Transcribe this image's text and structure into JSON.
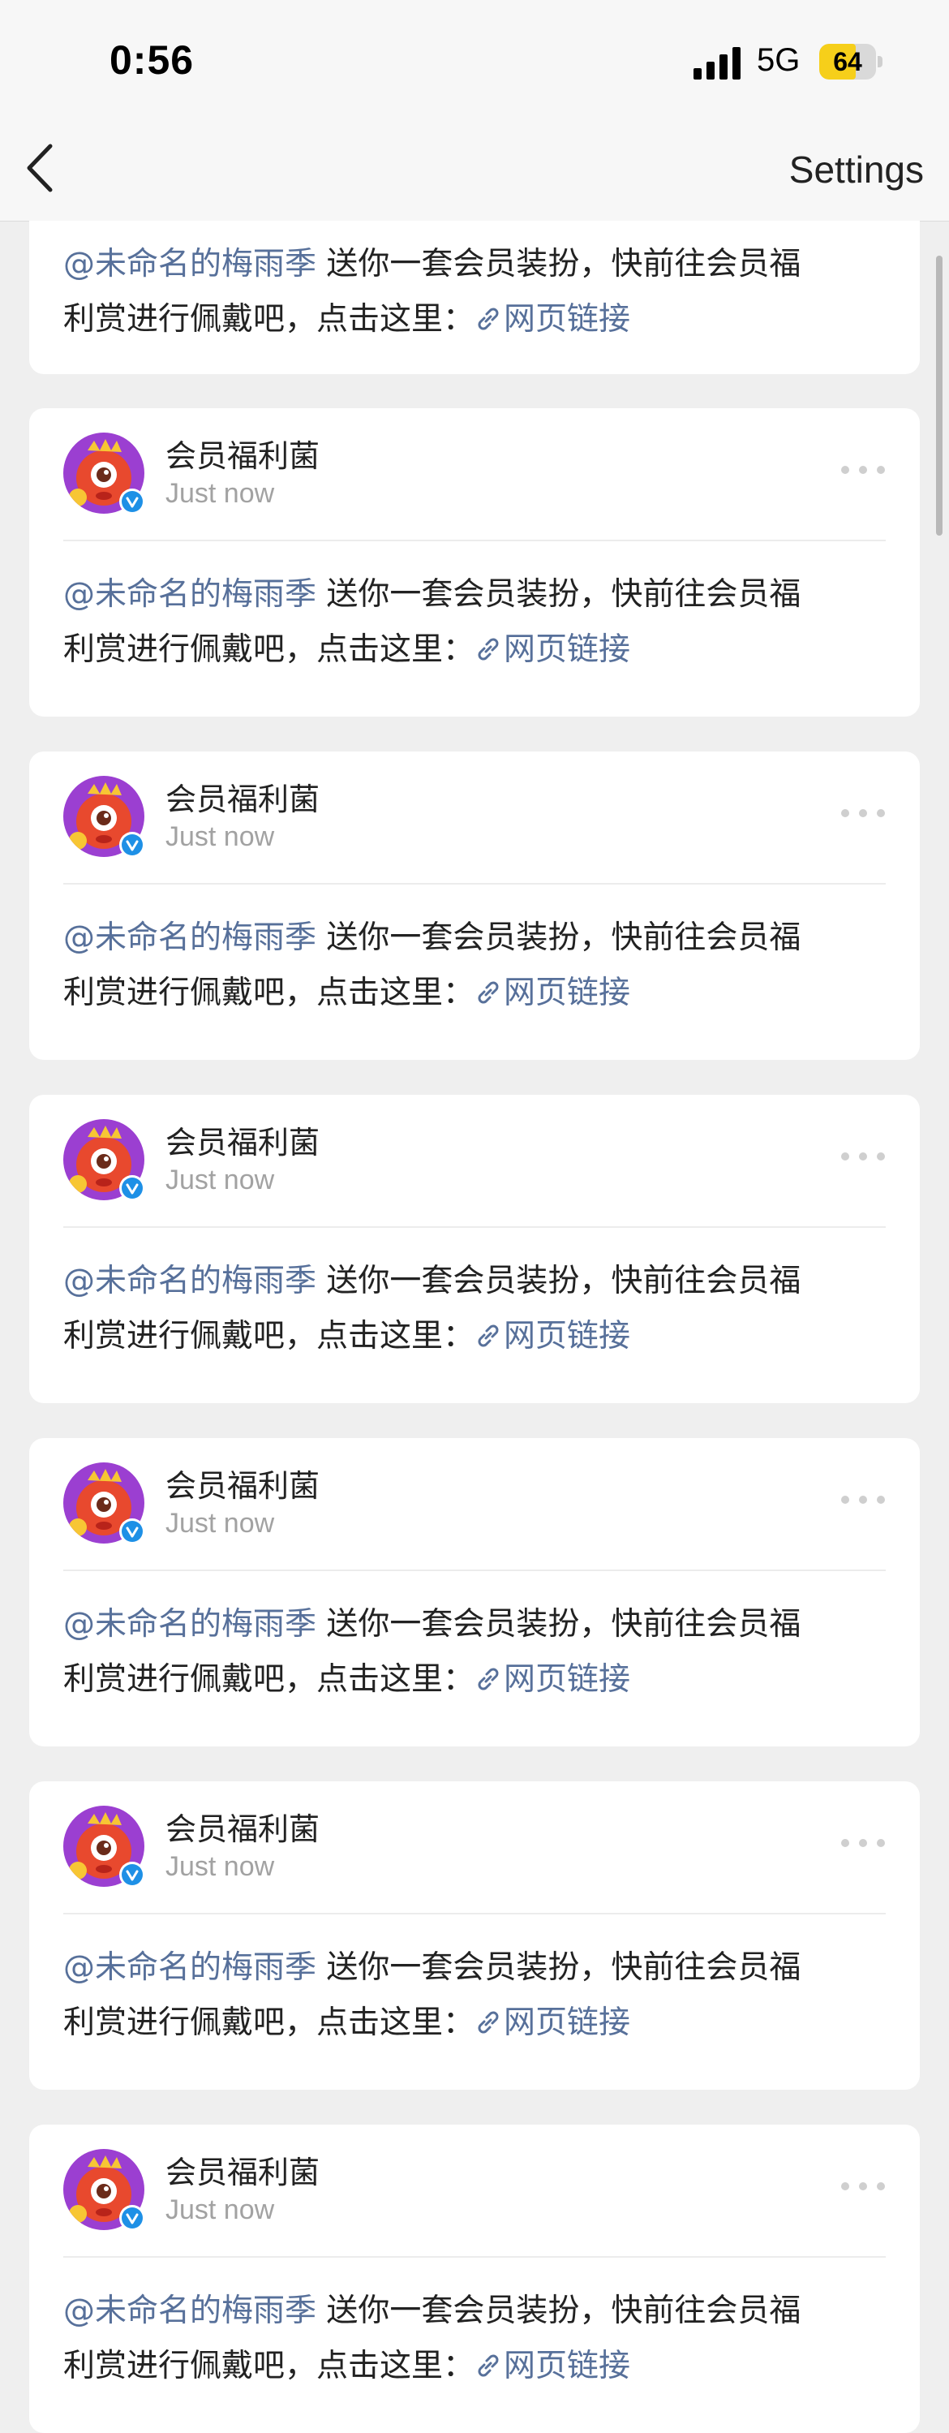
{
  "status_bar": {
    "time": "0:56",
    "network": "5G",
    "battery": "64",
    "battery_fill": 0.64
  },
  "nav": {
    "back_icon": "chevron-left-icon",
    "settings_label": "Settings"
  },
  "post_template": {
    "author": "会员福利菌",
    "time": "Just now",
    "mention": "@未命名的梅雨季",
    "text_line1": "送你一套会员装扮，快前往会员福",
    "text_line2": "利赏进行佩戴吧，点击这里：",
    "link_text": "网页链接"
  },
  "posts": [
    {
      "author": "会员福利菌",
      "time": "Just now",
      "mention": "@未命名的梅雨季",
      "text_line1": " 送你一套会员装扮，快前往会员福",
      "text_line2": "利赏进行佩戴吧，点击这里：",
      "link_text": "网页链接"
    },
    {
      "author": "会员福利菌",
      "time": "Just now",
      "mention": "@未命名的梅雨季",
      "text_line1": " 送你一套会员装扮，快前往会员福",
      "text_line2": "利赏进行佩戴吧，点击这里：",
      "link_text": "网页链接"
    },
    {
      "author": "会员福利菌",
      "time": "Just now",
      "mention": "@未命名的梅雨季",
      "text_line1": " 送你一套会员装扮，快前往会员福",
      "text_line2": "利赏进行佩戴吧，点击这里：",
      "link_text": "网页链接"
    },
    {
      "author": "会员福利菌",
      "time": "Just now",
      "mention": "@未命名的梅雨季",
      "text_line1": " 送你一套会员装扮，快前往会员福",
      "text_line2": "利赏进行佩戴吧，点击这里：",
      "link_text": "网页链接"
    },
    {
      "author": "会员福利菌",
      "time": "Just now",
      "mention": "@未命名的梅雨季",
      "text_line1": " 送你一套会员装扮，快前往会员福",
      "text_line2": "利赏进行佩戴吧，点击这里：",
      "link_text": "网页链接"
    },
    {
      "author": "会员福利菌",
      "time": "Just now",
      "mention": "@未命名的梅雨季",
      "text_line1": " 送你一套会员装扮，快前往会员福",
      "text_line2": "利赏进行佩戴吧，点击这里：",
      "link_text": "网页链接"
    }
  ],
  "colors": {
    "mention": "#57709a",
    "background": "#efefef",
    "verified_badge": "#1e90e6",
    "battery": "#f6cf1a"
  }
}
